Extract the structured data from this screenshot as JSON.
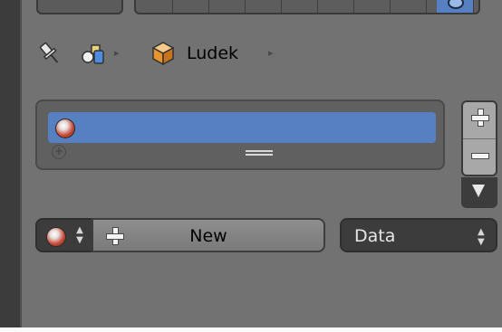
{
  "breadcrumb": {
    "object_name": "Ludek",
    "separator": "▸"
  },
  "material_slots": {
    "items": [
      {
        "name": ""
      }
    ],
    "add_slot_label": "+",
    "remove_slot_label": "−"
  },
  "material": {
    "new_label": "New",
    "link_type": "Data"
  },
  "icons": {
    "pin": "pin-icon",
    "object": "object-data-icon",
    "mesh": "cube-icon",
    "material": "material-sphere-icon",
    "add": "plus-icon",
    "remove": "minus-icon",
    "menu": "triangle-down-icon"
  },
  "colors": {
    "panel": "#727272",
    "selection": "#5680c2",
    "dark_widget": "#3c3c3c"
  }
}
